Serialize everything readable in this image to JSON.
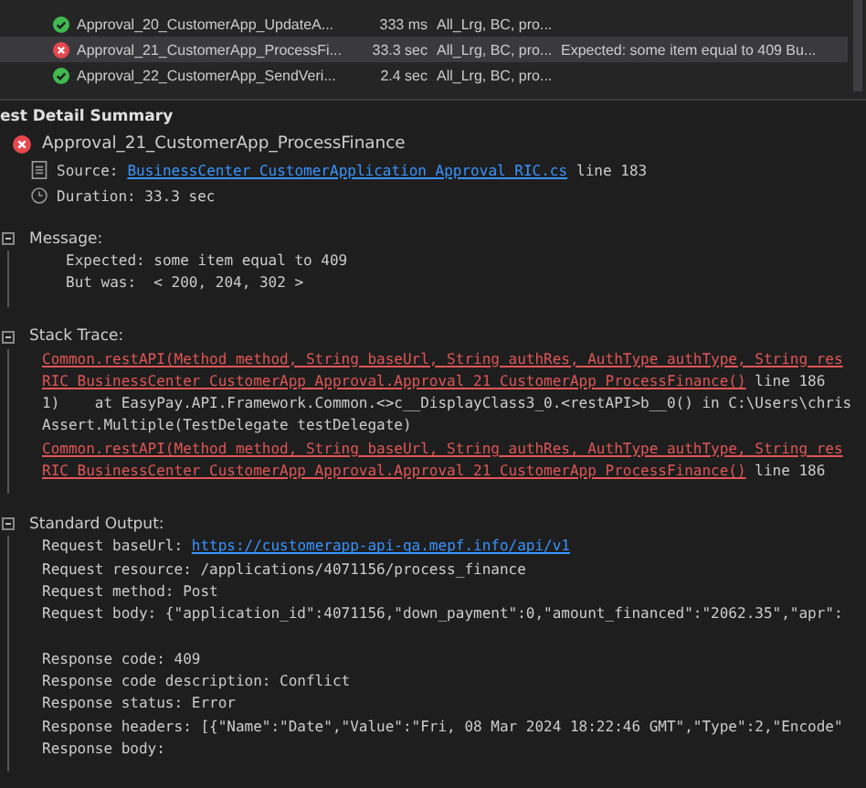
{
  "tests": [
    {
      "name": "Approval_20_CustomerApp_UpdateA...",
      "failed": false,
      "duration": "333 ms",
      "traits": "All_Lrg, BC, pro...",
      "selected": false
    },
    {
      "name": "Approval_21_CustomerApp_ProcessFi...",
      "failed": true,
      "duration": "33.3 sec",
      "traits": "All_Lrg, BC, pro...",
      "error": "Expected: some item equal to 409   Bu...",
      "selected": true
    },
    {
      "name": "Approval_22_CustomerApp_SendVeri...",
      "failed": false,
      "duration": "2.4 sec",
      "traits": "All_Lrg, BC, pro...",
      "selected": false
    }
  ],
  "detail": {
    "heading": "est Detail Summary",
    "test_name": "Approval_21_CustomerApp_ProcessFinance",
    "failed": true,
    "source_label": "Source:",
    "source_link": "BusinessCenter_CustomerApplication_Approval_RIC.cs",
    "source_line": "line 183",
    "duration": "Duration: 33.3 sec",
    "sections": [
      {
        "title": "Message:",
        "kind": "message",
        "lines": [
          {
            "segments": [
              {
                "kind": "text",
                "text": "Expected: some item equal to 409"
              }
            ]
          },
          {
            "segments": [
              {
                "kind": "text",
                "text": "But was:  < 200, 204, 302 >"
              }
            ]
          }
        ]
      },
      {
        "title": "Stack Trace:",
        "kind": "code",
        "lines": [
          {
            "segments": [
              {
                "kind": "error_link",
                "text": "Common.restAPI(Method method, String baseUrl, String authRes, AuthType authType, String res"
              }
            ]
          },
          {
            "segments": [
              {
                "kind": "error_link",
                "text": "RIC_BusinessCenter_CustomerApp_Approval.Approval_21_CustomerApp_ProcessFinance()"
              },
              {
                "kind": "text",
                "text": " line 186"
              }
            ]
          },
          {
            "segments": [
              {
                "kind": "text",
                "text": "1)    at EasyPay.API.Framework.Common.<>c__DisplayClass3_0.<restAPI>b__0() in C:\\Users\\chris"
              }
            ]
          },
          {
            "segments": [
              {
                "kind": "text",
                "text": "Assert.Multiple(TestDelegate testDelegate)"
              }
            ]
          },
          {
            "segments": [
              {
                "kind": "error_link",
                "text": "Common.restAPI(Method method, String baseUrl, String authRes, AuthType authType, String res"
              }
            ]
          },
          {
            "segments": [
              {
                "kind": "error_link",
                "text": "RIC_BusinessCenter_CustomerApp_Approval.Approval_21_CustomerApp_ProcessFinance()"
              },
              {
                "kind": "text",
                "text": " line 186"
              }
            ]
          }
        ]
      },
      {
        "title": "Standard Output:",
        "kind": "code",
        "lines": [
          {
            "segments": [
              {
                "kind": "text",
                "text": "Request baseUrl: "
              },
              {
                "kind": "link",
                "text": "https://customerapp-api-qa.mepf.info/api/v1"
              }
            ]
          },
          {
            "segments": [
              {
                "kind": "text",
                "text": "Request resource: /applications/4071156/process_finance"
              }
            ]
          },
          {
            "segments": [
              {
                "kind": "text",
                "text": "Request method: Post"
              }
            ]
          },
          {
            "segments": [
              {
                "kind": "text",
                "text": "Request body: {\"application_id\":4071156,\"down_payment\":0,\"amount_financed\":\"2062.35\",\"apr\":"
              }
            ]
          },
          {
            "gap_before": true,
            "segments": [
              {
                "kind": "text",
                "text": "Response code: 409"
              }
            ]
          },
          {
            "segments": [
              {
                "kind": "text",
                "text": "Response code description: Conflict"
              }
            ]
          },
          {
            "segments": [
              {
                "kind": "text",
                "text": "Response status: Error"
              }
            ]
          },
          {
            "segments": [
              {
                "kind": "text",
                "text": "Response headers: [{\"Name\":\"Date\",\"Value\":\"Fri, 08 Mar 2024 18:22:46 GMT\",\"Type\":2,\"Encode\""
              }
            ]
          },
          {
            "segments": [
              {
                "kind": "text",
                "text": "Response body:"
              }
            ]
          }
        ]
      }
    ]
  }
}
